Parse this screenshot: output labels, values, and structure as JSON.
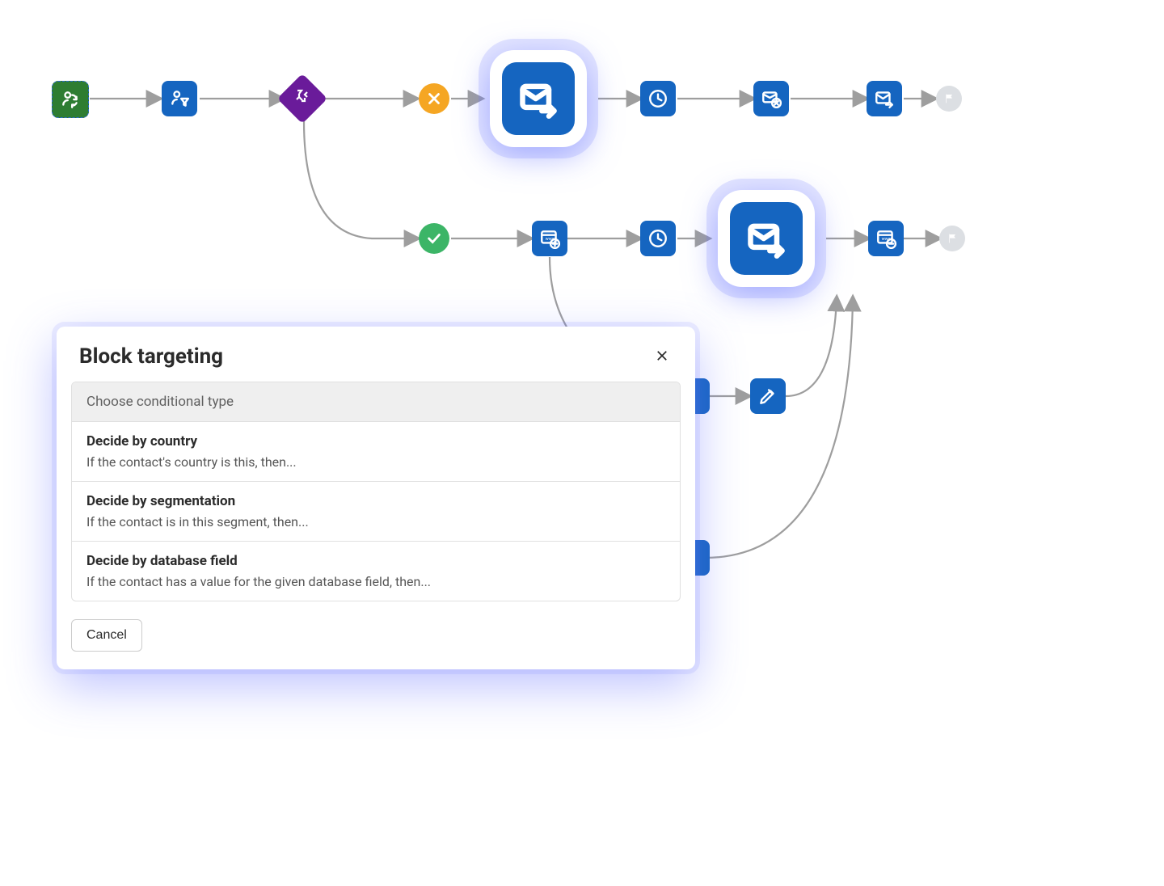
{
  "flow": {
    "nodes": {
      "start": "contact-sync",
      "segment": "contact-filter",
      "decision": "decision-branch",
      "no_branch": "no",
      "yes_branch": "yes",
      "top_email_hl": "send-email",
      "wait_top": "wait",
      "email_cancel": "cancel-mail",
      "email_send_top": "send-email",
      "end_top": "end",
      "web_add": "web-add",
      "wait_bot": "wait",
      "bot_email_hl": "send-email",
      "web_remove": "web-remove",
      "end_bot": "end",
      "edit": "edit-field",
      "block_partial": "block"
    }
  },
  "modal": {
    "title": "Block targeting",
    "group_header": "Choose conditional type",
    "options": [
      {
        "title": "Decide by country",
        "sub": "If the contact's country is this, then..."
      },
      {
        "title": "Decide by segmentation",
        "sub": "If the contact is in this segment, then..."
      },
      {
        "title": "Decide by database field",
        "sub": "If the contact has a value for the given database field, then..."
      }
    ],
    "cancel": "Cancel"
  }
}
